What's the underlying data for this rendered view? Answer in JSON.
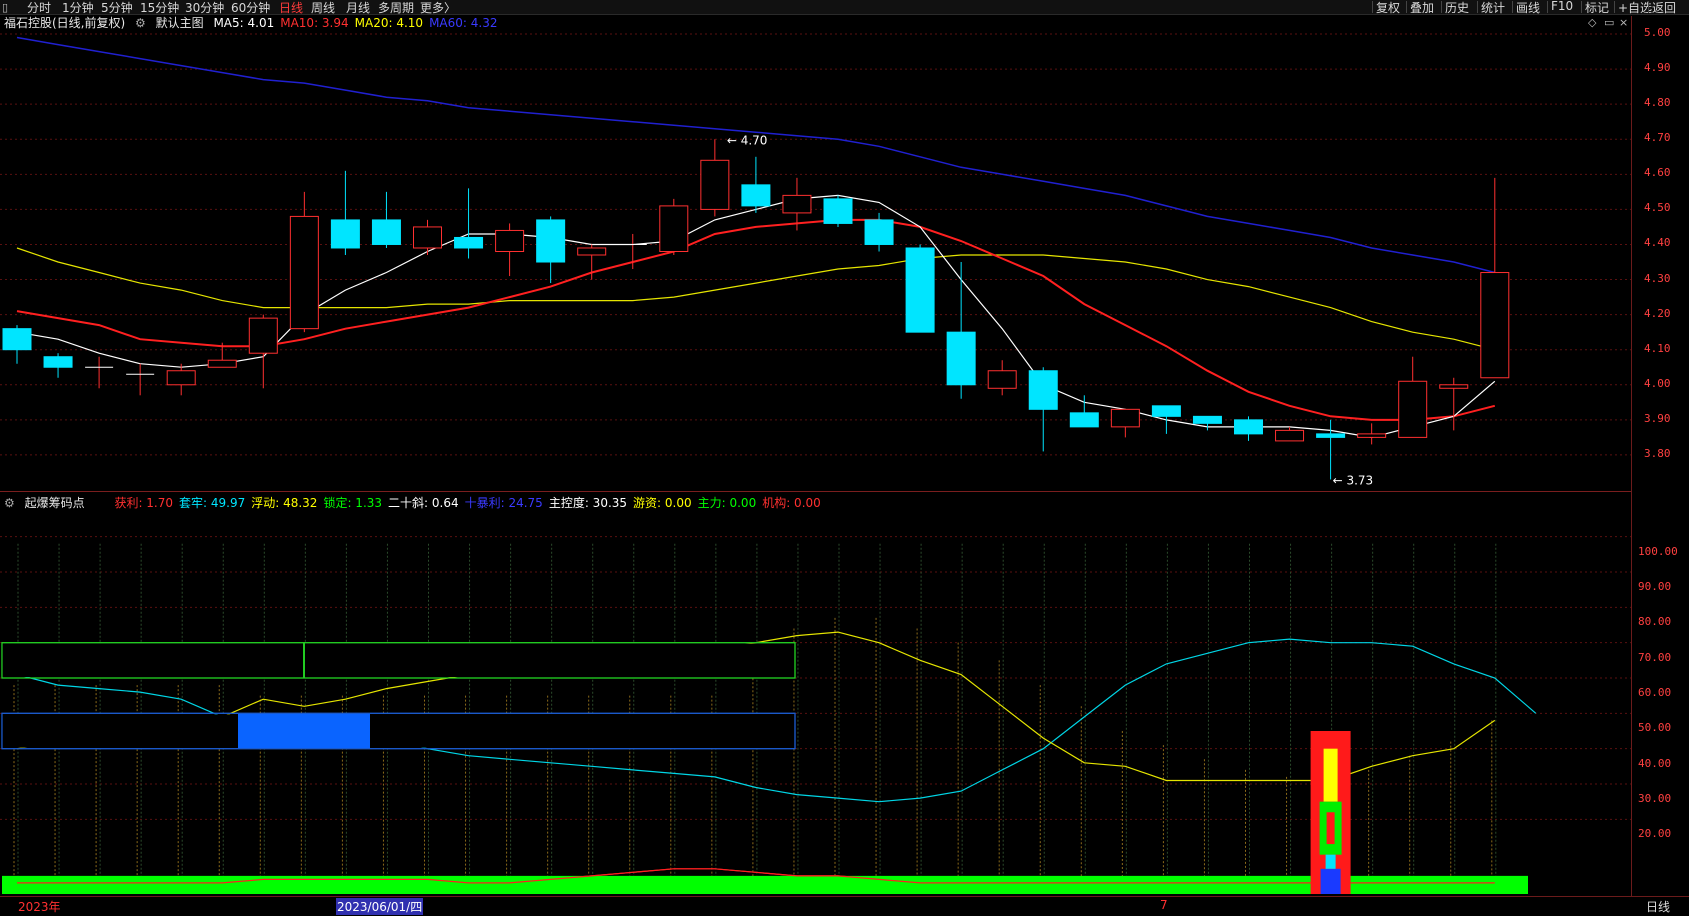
{
  "toolbar": {
    "periods": [
      {
        "label": "分时",
        "active": false
      },
      {
        "label": "1分钟",
        "active": false
      },
      {
        "label": "5分钟",
        "active": false
      },
      {
        "label": "15分钟",
        "active": false
      },
      {
        "label": "30分钟",
        "active": false
      },
      {
        "label": "60分钟",
        "active": false
      },
      {
        "label": "日线",
        "active": true
      },
      {
        "label": "周线",
        "active": false
      },
      {
        "label": "月线",
        "active": false
      },
      {
        "label": "多周期",
        "active": false
      },
      {
        "label": "更多〉",
        "active": false
      }
    ],
    "actions": [
      "复权",
      "叠加",
      "历史",
      "统计",
      "画线",
      "F10",
      "标记",
      "+自选",
      "返回"
    ]
  },
  "main_header": {
    "title": "福石控股(日线,前复权)",
    "overlay": "默认主图",
    "ma": [
      {
        "label": "MA5: 4.01",
        "color": "#ffffff"
      },
      {
        "label": "MA10: 3.94",
        "color": "#ff3030"
      },
      {
        "label": "MA20: 4.10",
        "color": "#ffff00"
      },
      {
        "label": "MA60: 4.32",
        "color": "#3a3aff"
      }
    ]
  },
  "sub_header": {
    "title": "起爆筹码点",
    "items": [
      {
        "label": "获利: 1.70",
        "color": "#ff3030"
      },
      {
        "label": "套牢: 49.97",
        "color": "#00e5ff"
      },
      {
        "label": "浮动: 48.32",
        "color": "#ffff00"
      },
      {
        "label": "锁定: 1.33",
        "color": "#00ff00"
      },
      {
        "label": "二十斜: 0.64",
        "color": "#ffffff"
      },
      {
        "label": "十暴利: 24.75",
        "color": "#3a3aff"
      },
      {
        "label": "主控度: 30.35",
        "color": "#ffffff"
      },
      {
        "label": "游资: 0.00",
        "color": "#ffff00"
      },
      {
        "label": "主力: 0.00",
        "color": "#00ff00"
      },
      {
        "label": "机构: 0.00",
        "color": "#ff3030"
      }
    ]
  },
  "price_axis": [
    "5.00",
    "4.90",
    "4.80",
    "4.70",
    "4.60",
    "4.50",
    "4.40",
    "4.30",
    "4.20",
    "4.10",
    "4.00",
    "3.90",
    "3.80"
  ],
  "sub_axis": [
    "100.00",
    "90.00",
    "80.00",
    "70.00",
    "60.00",
    "50.00",
    "40.00",
    "30.00",
    "20.00"
  ],
  "annotations": {
    "high": "4.70",
    "low": "3.73"
  },
  "bottom": {
    "year": "2023年",
    "date": "2023/06/01/四",
    "month": "7",
    "period": "日线"
  },
  "colors": {
    "up": "#ff3030",
    "down": "#00e5ff",
    "ma5": "#ffffff",
    "ma10": "#ff2020",
    "ma20": "#e5e500",
    "ma60": "#2020d0"
  },
  "chart_data": {
    "type": "candlestick",
    "candles": [
      [
        4.16,
        4.1,
        4.17,
        4.06
      ],
      [
        4.08,
        4.05,
        4.09,
        4.02
      ],
      [
        4.05,
        4.05,
        4.08,
        3.99
      ],
      [
        4.03,
        4.03,
        4.06,
        3.97
      ],
      [
        4.0,
        4.04,
        4.06,
        3.97
      ],
      [
        4.05,
        4.07,
        4.12,
        4.05
      ],
      [
        4.09,
        4.19,
        4.2,
        3.99
      ],
      [
        4.16,
        4.48,
        4.55,
        4.15
      ],
      [
        4.47,
        4.39,
        4.61,
        4.37
      ],
      [
        4.47,
        4.4,
        4.55,
        4.39
      ],
      [
        4.39,
        4.45,
        4.47,
        4.37
      ],
      [
        4.42,
        4.39,
        4.56,
        4.36
      ],
      [
        4.38,
        4.44,
        4.46,
        4.31
      ],
      [
        4.47,
        4.35,
        4.48,
        4.29
      ],
      [
        4.37,
        4.39,
        4.4,
        4.3
      ],
      [
        4.4,
        4.4,
        4.43,
        4.33
      ],
      [
        4.38,
        4.51,
        4.53,
        4.37
      ],
      [
        4.5,
        4.64,
        4.7,
        4.48
      ],
      [
        4.57,
        4.51,
        4.65,
        4.49
      ],
      [
        4.49,
        4.54,
        4.59,
        4.44
      ],
      [
        4.53,
        4.46,
        4.54,
        4.45
      ],
      [
        4.47,
        4.4,
        4.49,
        4.38
      ],
      [
        4.39,
        4.15,
        4.4,
        4.15
      ],
      [
        4.15,
        4.0,
        4.35,
        3.96
      ],
      [
        3.99,
        4.04,
        4.07,
        3.97
      ],
      [
        4.04,
        3.93,
        4.05,
        3.81
      ],
      [
        3.92,
        3.88,
        3.97,
        3.88
      ],
      [
        3.88,
        3.93,
        3.93,
        3.85
      ],
      [
        3.94,
        3.91,
        3.94,
        3.86
      ],
      [
        3.91,
        3.89,
        3.91,
        3.87
      ],
      [
        3.9,
        3.86,
        3.91,
        3.84
      ],
      [
        3.84,
        3.87,
        3.88,
        3.84
      ],
      [
        3.86,
        3.85,
        3.9,
        3.73
      ],
      [
        3.85,
        3.86,
        3.89,
        3.83
      ],
      [
        3.85,
        4.01,
        4.08,
        3.85
      ],
      [
        3.99,
        4.0,
        4.02,
        3.87
      ],
      [
        4.02,
        4.32,
        4.59,
        4.02
      ]
    ],
    "ma5": [
      4.15,
      4.13,
      4.09,
      4.06,
      4.05,
      4.06,
      4.08,
      4.2,
      4.27,
      4.32,
      4.38,
      4.43,
      4.43,
      4.42,
      4.4,
      4.4,
      4.41,
      4.47,
      4.5,
      4.53,
      4.54,
      4.52,
      4.45,
      4.3,
      4.16,
      4.0,
      3.95,
      3.93,
      3.9,
      3.88,
      3.88,
      3.88,
      3.87,
      3.85,
      3.88,
      3.91,
      4.01
    ],
    "ma10": [
      4.21,
      4.19,
      4.17,
      4.13,
      4.12,
      4.11,
      4.11,
      4.13,
      4.16,
      4.18,
      4.2,
      4.22,
      4.25,
      4.28,
      4.32,
      4.35,
      4.38,
      4.43,
      4.45,
      4.46,
      4.47,
      4.47,
      4.45,
      4.41,
      4.36,
      4.31,
      4.23,
      4.17,
      4.11,
      4.04,
      3.98,
      3.94,
      3.91,
      3.9,
      3.9,
      3.91,
      3.94
    ],
    "ma20": [
      4.39,
      4.35,
      4.32,
      4.29,
      4.27,
      4.24,
      4.22,
      4.22,
      4.22,
      4.22,
      4.23,
      4.23,
      4.24,
      4.24,
      4.24,
      4.24,
      4.25,
      4.27,
      4.29,
      4.31,
      4.33,
      4.34,
      4.36,
      4.37,
      4.37,
      4.37,
      4.36,
      4.35,
      4.33,
      4.3,
      4.28,
      4.25,
      4.22,
      4.18,
      4.15,
      4.13,
      4.1
    ],
    "ma60": [
      4.99,
      4.97,
      4.95,
      4.93,
      4.91,
      4.89,
      4.87,
      4.86,
      4.84,
      4.82,
      4.81,
      4.79,
      4.78,
      4.77,
      4.76,
      4.75,
      4.74,
      4.73,
      4.72,
      4.71,
      4.7,
      4.68,
      4.65,
      4.62,
      4.6,
      4.58,
      4.56,
      4.54,
      4.51,
      4.48,
      4.46,
      4.44,
      4.42,
      4.39,
      4.37,
      4.35,
      4.32
    ],
    "price_range": [
      3.7,
      5.04
    ],
    "sub": {
      "range": [
        0,
        105
      ],
      "trapped": [
        61,
        58,
        57,
        56,
        54,
        49,
        44,
        48,
        45,
        43,
        40,
        38,
        37,
        36,
        35,
        34,
        33,
        32,
        29,
        27,
        26,
        25,
        26,
        28,
        34,
        40,
        49,
        58,
        64,
        67,
        70,
        71,
        70,
        70,
        69,
        64,
        60,
        50
      ],
      "floating": [
        40,
        42,
        43,
        44,
        45,
        49,
        54,
        52,
        54,
        57,
        59,
        61,
        63,
        65,
        66,
        67,
        67,
        68,
        70,
        72,
        73,
        70,
        65,
        61,
        52,
        43,
        36,
        35,
        31,
        31,
        31,
        31,
        31,
        35,
        38,
        40,
        48
      ],
      "profit": [
        2,
        2,
        2,
        2,
        2,
        2,
        3,
        3,
        3,
        3,
        3,
        2,
        2,
        3,
        4,
        5,
        6,
        6,
        5,
        4,
        4,
        3,
        2,
        2,
        2,
        2,
        2,
        2,
        2,
        2,
        2,
        2,
        2,
        2,
        2,
        2,
        2
      ],
      "volume_lines": [
        98,
        98,
        98,
        98,
        98,
        98,
        98,
        98,
        98,
        98,
        98,
        98,
        98,
        98,
        98,
        98,
        98,
        98,
        98,
        98,
        98,
        98,
        98,
        98,
        98,
        98,
        98,
        98,
        98,
        98,
        98,
        98,
        98,
        98,
        98,
        98,
        98
      ],
      "floating_bars": [
        58,
        58,
        58,
        58,
        58,
        58,
        55,
        55,
        55,
        55,
        55,
        55,
        55,
        55,
        55,
        55,
        55,
        55,
        69,
        74,
        77,
        77,
        74,
        70,
        65,
        58,
        52,
        45,
        41,
        37,
        34,
        32,
        32,
        34,
        38,
        42,
        48
      ]
    }
  }
}
